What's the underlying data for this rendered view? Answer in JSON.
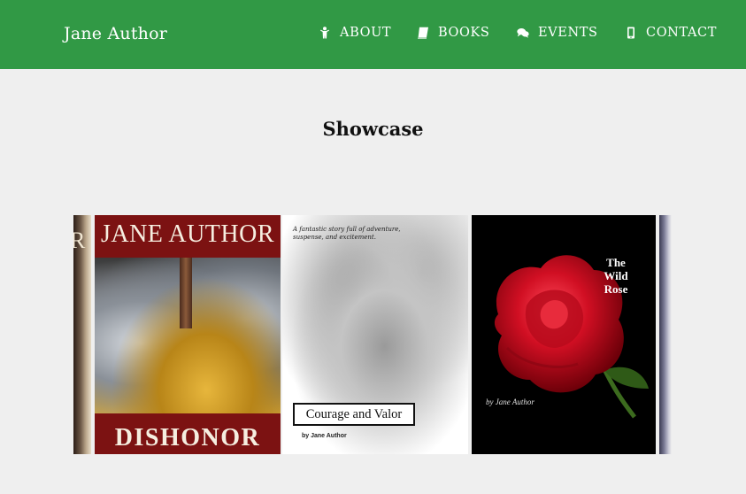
{
  "navbar": {
    "brand": "Jane Author",
    "items": [
      {
        "label": "ABOUT",
        "icon": "person-icon"
      },
      {
        "label": "BOOKS",
        "icon": "book-icon"
      },
      {
        "label": "EVENTS",
        "icon": "chat-icon"
      },
      {
        "label": "CONTACT",
        "icon": "mobile-phone-icon"
      }
    ]
  },
  "colors": {
    "navbar_bg": "#319945",
    "page_bg": "#efefef",
    "nav_text": "#ffffff"
  },
  "showcase": {
    "title": "Showcase",
    "prev_edge_text": "R",
    "books": [
      {
        "top_text": "JANE AUTHOR",
        "title": "DISHONOR"
      },
      {
        "tagline": "A fantastic story full of adventure, suspense, and excitement.",
        "title": "Courage and Valor",
        "byline": "by Jane Author"
      },
      {
        "title_lines": [
          "The",
          "Wild",
          "Rose"
        ],
        "byline": "by Jane Author"
      }
    ]
  }
}
